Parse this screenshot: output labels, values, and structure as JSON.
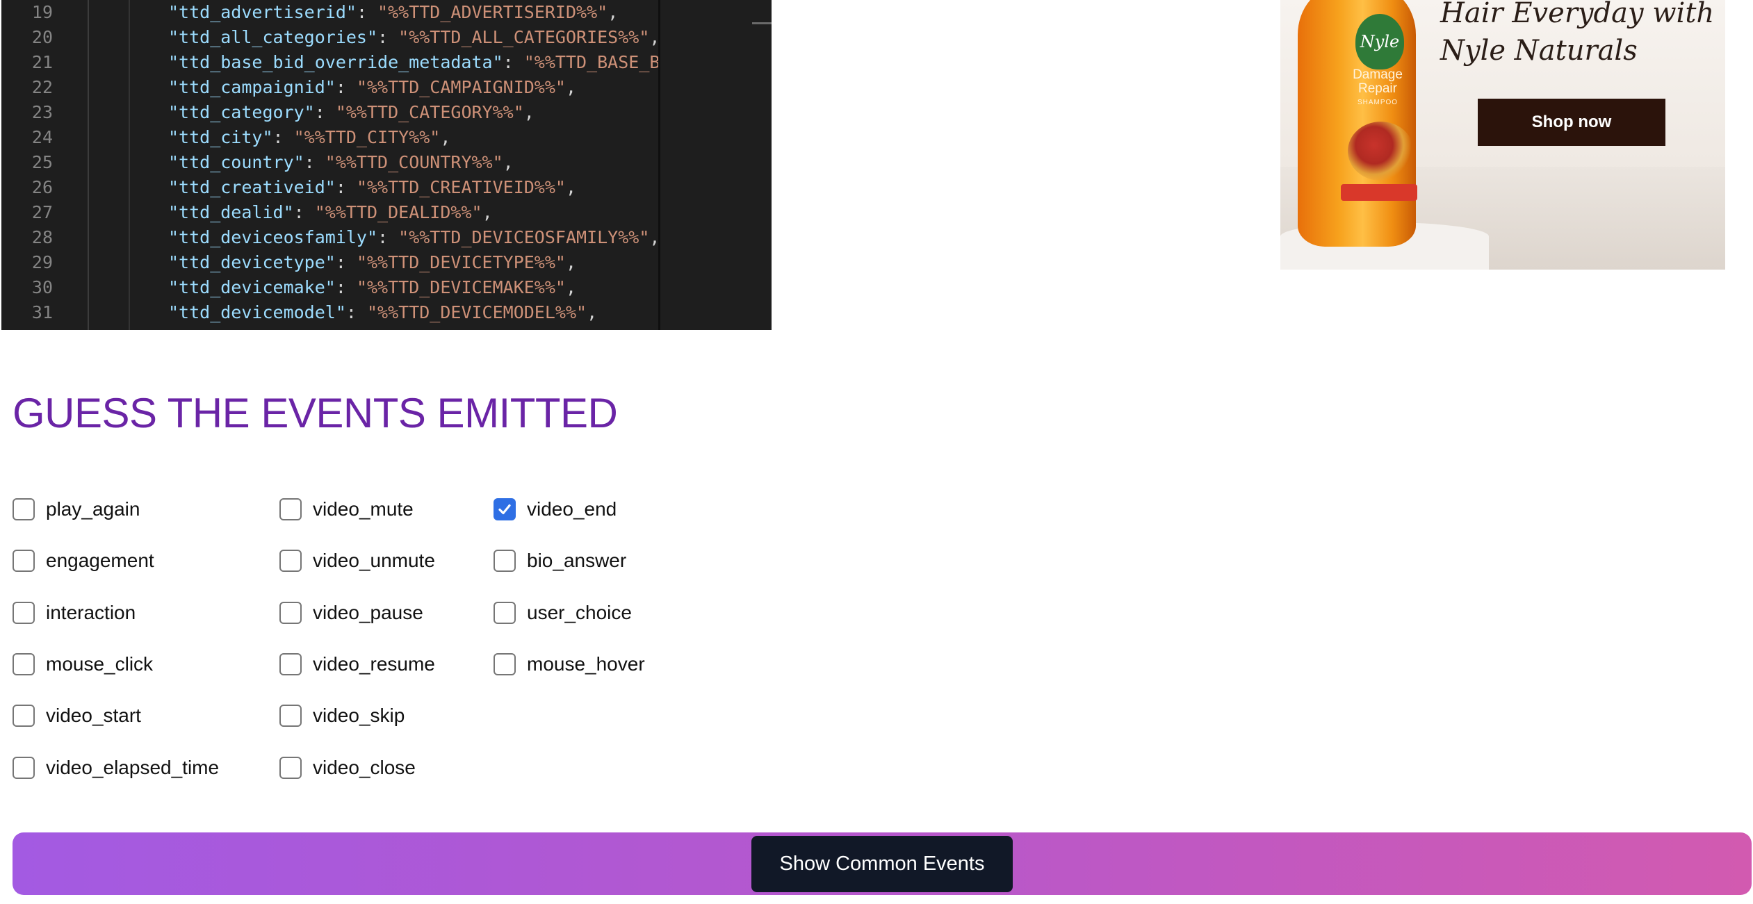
{
  "editor": {
    "lines": [
      {
        "num": "19",
        "key": "\"ttd_advertiserid\"",
        "sep": ": ",
        "val": "\"%%TTD_ADVERTISERID%%\"",
        "end": ","
      },
      {
        "num": "20",
        "key": "\"ttd_all_categories\"",
        "sep": ": ",
        "val": "\"%%TTD_ALL_CATEGORIES%%\"",
        "end": ","
      },
      {
        "num": "21",
        "key": "\"ttd_base_bid_override_metadata\"",
        "sep": ": ",
        "val": "\"%%TTD_BASE_BID",
        "end": ""
      },
      {
        "num": "22",
        "key": "\"ttd_campaignid\"",
        "sep": ": ",
        "val": "\"%%TTD_CAMPAIGNID%%\"",
        "end": ","
      },
      {
        "num": "23",
        "key": "\"ttd_category\"",
        "sep": ": ",
        "val": "\"%%TTD_CATEGORY%%\"",
        "end": ","
      },
      {
        "num": "24",
        "key": "\"ttd_city\"",
        "sep": ": ",
        "val": "\"%%TTD_CITY%%\"",
        "end": ","
      },
      {
        "num": "25",
        "key": "\"ttd_country\"",
        "sep": ": ",
        "val": "\"%%TTD_COUNTRY%%\"",
        "end": ","
      },
      {
        "num": "26",
        "key": "\"ttd_creativeid\"",
        "sep": ": ",
        "val": "\"%%TTD_CREATIVEID%%\"",
        "end": ","
      },
      {
        "num": "27",
        "key": "\"ttd_dealid\"",
        "sep": ": ",
        "val": "\"%%TTD_DEALID%%\"",
        "end": ","
      },
      {
        "num": "28",
        "key": "\"ttd_deviceosfamily\"",
        "sep": ": ",
        "val": "\"%%TTD_DEVICEOSFAMILY%%\"",
        "end": ","
      },
      {
        "num": "29",
        "key": "\"ttd_devicetype\"",
        "sep": ": ",
        "val": "\"%%TTD_DEVICETYPE%%\"",
        "end": ","
      },
      {
        "num": "30",
        "key": "\"ttd_devicemake\"",
        "sep": ": ",
        "val": "\"%%TTD_DEVICEMAKE%%\"",
        "end": ","
      },
      {
        "num": "31",
        "key": "\"ttd_devicemodel\"",
        "sep": ": ",
        "val": "\"%%TTD_DEVICEMODEL%%\"",
        "end": ","
      }
    ]
  },
  "ad": {
    "headline_line1": "Hair Everyday with",
    "headline_line2": "Nyle Naturals",
    "cta": "Shop now",
    "bottle_brand": "Nyle",
    "bottle_label": "Damage Repair",
    "bottle_sub": "SHAMPOO"
  },
  "quiz": {
    "title": "GUESS THE EVENTS EMITTED",
    "columns": [
      [
        {
          "label": "play_again",
          "checked": false
        },
        {
          "label": "engagement",
          "checked": false
        },
        {
          "label": "interaction",
          "checked": false
        },
        {
          "label": "mouse_click",
          "checked": false
        },
        {
          "label": "video_start",
          "checked": false
        },
        {
          "label": "video_elapsed_time",
          "checked": false
        }
      ],
      [
        {
          "label": "video_mute",
          "checked": false
        },
        {
          "label": "video_unmute",
          "checked": false
        },
        {
          "label": "video_pause",
          "checked": false
        },
        {
          "label": "video_resume",
          "checked": false
        },
        {
          "label": "video_skip",
          "checked": false
        },
        {
          "label": "video_close",
          "checked": false
        }
      ],
      [
        {
          "label": "video_end",
          "checked": true
        },
        {
          "label": "bio_answer",
          "checked": false
        },
        {
          "label": "user_choice",
          "checked": false
        },
        {
          "label": "mouse_hover",
          "checked": false
        }
      ]
    ]
  },
  "bottom": {
    "button_label": "Show Common Events"
  },
  "colors": {
    "title": "#6a24a6",
    "checkbox_checked": "#2f6fe4",
    "button_bg": "#111827",
    "bar_gradient_start": "#a35ae2",
    "bar_gradient_end": "#d25ab0"
  }
}
